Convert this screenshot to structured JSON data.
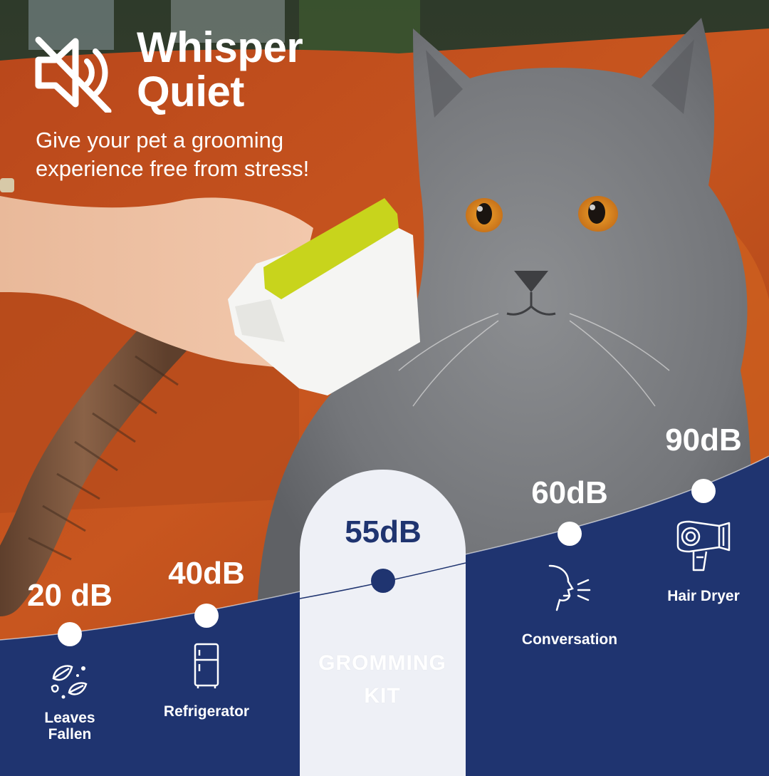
{
  "headline": {
    "title_line1": "Whisper",
    "title_line2": "Quiet",
    "tagline_line1": "Give your pet a grooming",
    "tagline_line2": "experience free from stress!"
  },
  "noise_scale": {
    "unit": "dB",
    "items": [
      {
        "value_label": "20 dB",
        "db": 20,
        "label_line1": "Leaves",
        "label_line2": "Fallen",
        "icon": "leaves-icon"
      },
      {
        "value_label": "40dB",
        "db": 40,
        "label_line1": "Refrigerator",
        "label_line2": "",
        "icon": "refrigerator-icon"
      },
      {
        "value_label": "55dB",
        "db": 55,
        "label_line1": "GROMMING",
        "label_line2": "KIT",
        "icon": "",
        "highlighted": true
      },
      {
        "value_label": "60dB",
        "db": 60,
        "label_line1": "Conversation",
        "label_line2": "",
        "icon": "speaking-face-icon"
      },
      {
        "value_label": "90dB",
        "db": 90,
        "label_line1": "Hair Dryer",
        "label_line2": "",
        "icon": "hair-dryer-icon"
      }
    ]
  },
  "colors": {
    "navy": "#1f3470",
    "highlight_card": "#eef0f6",
    "sofa_orange": "#c4541f",
    "cat_gray": "#7d7f82",
    "brush_yellow": "#c8d41c",
    "text_white": "#ffffff"
  }
}
